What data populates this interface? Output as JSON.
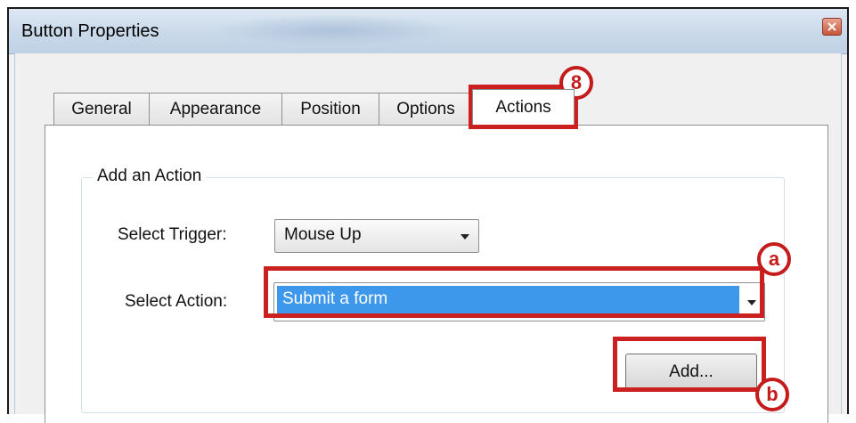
{
  "window": {
    "title": "Button Properties",
    "close_icon": "close-icon"
  },
  "tabs": [
    {
      "label": "General",
      "active": false
    },
    {
      "label": "Appearance",
      "active": false
    },
    {
      "label": "Position",
      "active": false
    },
    {
      "label": "Options",
      "active": false
    },
    {
      "label": "Actions",
      "active": true
    }
  ],
  "add_action": {
    "group_title": "Add an Action",
    "trigger_label": "Select Trigger:",
    "trigger_value": "Mouse Up",
    "action_label": "Select Action:",
    "action_value": "Submit a form",
    "add_button": "Add..."
  },
  "annotations": {
    "actions_tab": "8",
    "action_select": "a",
    "add_button": "b"
  },
  "colors": {
    "highlight_border": "#cc1f1f",
    "selection": "#3d97ea"
  }
}
